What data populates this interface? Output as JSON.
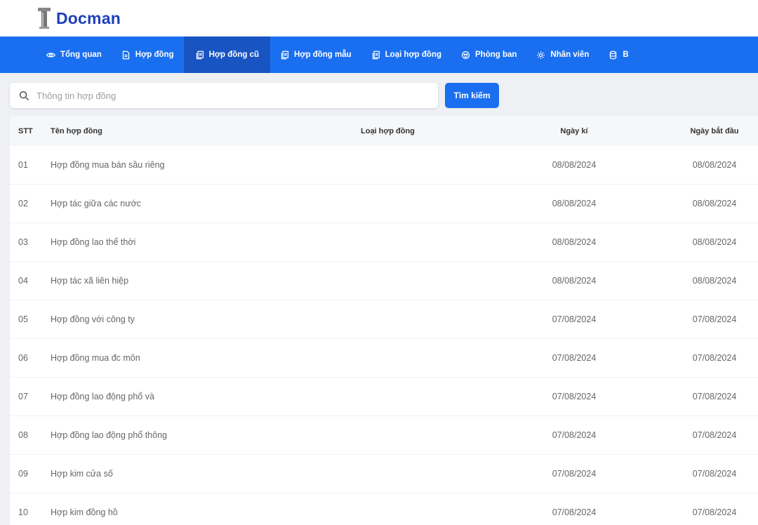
{
  "app": {
    "name": "Docman"
  },
  "nav": {
    "items": [
      {
        "label": "Tổng quan",
        "icon": "eye-icon"
      },
      {
        "label": "Hợp đồng",
        "icon": "document-icon"
      },
      {
        "label": "Hợp đồng cũ",
        "icon": "documents-icon"
      },
      {
        "label": "Hợp đồng mẫu",
        "icon": "documents-icon"
      },
      {
        "label": "Loại hợp đồng",
        "icon": "documents-icon"
      },
      {
        "label": "Phòng ban",
        "icon": "group-icon"
      },
      {
        "label": "Nhân viên",
        "icon": "gear-icon"
      },
      {
        "label": "B",
        "icon": "database-icon"
      }
    ],
    "active_index": 2
  },
  "search": {
    "placeholder": "Thông tin hợp đồng",
    "value": "",
    "button_label": "Tìm kiếm"
  },
  "table": {
    "headers": {
      "stt": "STT",
      "name": "Tên hợp đồng",
      "type": "Loại hợp đồng",
      "sign_date": "Ngày kí",
      "start_date": "Ngày bắt đầu"
    },
    "rows": [
      {
        "stt": "01",
        "name": "Hợp đồng mua bán sầu riêng",
        "type": "",
        "sign_date": "08/08/2024",
        "start_date": "08/08/2024"
      },
      {
        "stt": "02",
        "name": "Hợp tác giữa các nước",
        "type": "",
        "sign_date": "08/08/2024",
        "start_date": "08/08/2024"
      },
      {
        "stt": "03",
        "name": "Hợp đồng lao thể thời",
        "type": "",
        "sign_date": "08/08/2024",
        "start_date": "08/08/2024"
      },
      {
        "stt": "04",
        "name": "Hợp tác xã liên hiệp",
        "type": "",
        "sign_date": "08/08/2024",
        "start_date": "08/08/2024"
      },
      {
        "stt": "05",
        "name": "Hợp đồng với công ty",
        "type": "",
        "sign_date": "07/08/2024",
        "start_date": "07/08/2024"
      },
      {
        "stt": "06",
        "name": "Hợp đồng mua đc môn",
        "type": "",
        "sign_date": "07/08/2024",
        "start_date": "07/08/2024"
      },
      {
        "stt": "07",
        "name": "Hợp đồng lao động phổ và",
        "type": "",
        "sign_date": "07/08/2024",
        "start_date": "07/08/2024"
      },
      {
        "stt": "08",
        "name": "Hợp đồng lao động phổ thông",
        "type": "",
        "sign_date": "07/08/2024",
        "start_date": "07/08/2024"
      },
      {
        "stt": "09",
        "name": "Hợp kim cửa số",
        "type": "",
        "sign_date": "07/08/2024",
        "start_date": "07/08/2024"
      },
      {
        "stt": "10",
        "name": "Hợp kim đồng hồ",
        "type": "",
        "sign_date": "07/08/2024",
        "start_date": "07/08/2024"
      }
    ]
  },
  "colors": {
    "primary": "#1a6ff0",
    "nav_active": "#1854c2",
    "logo": "#1e3fb8",
    "background": "#eef0f3"
  }
}
